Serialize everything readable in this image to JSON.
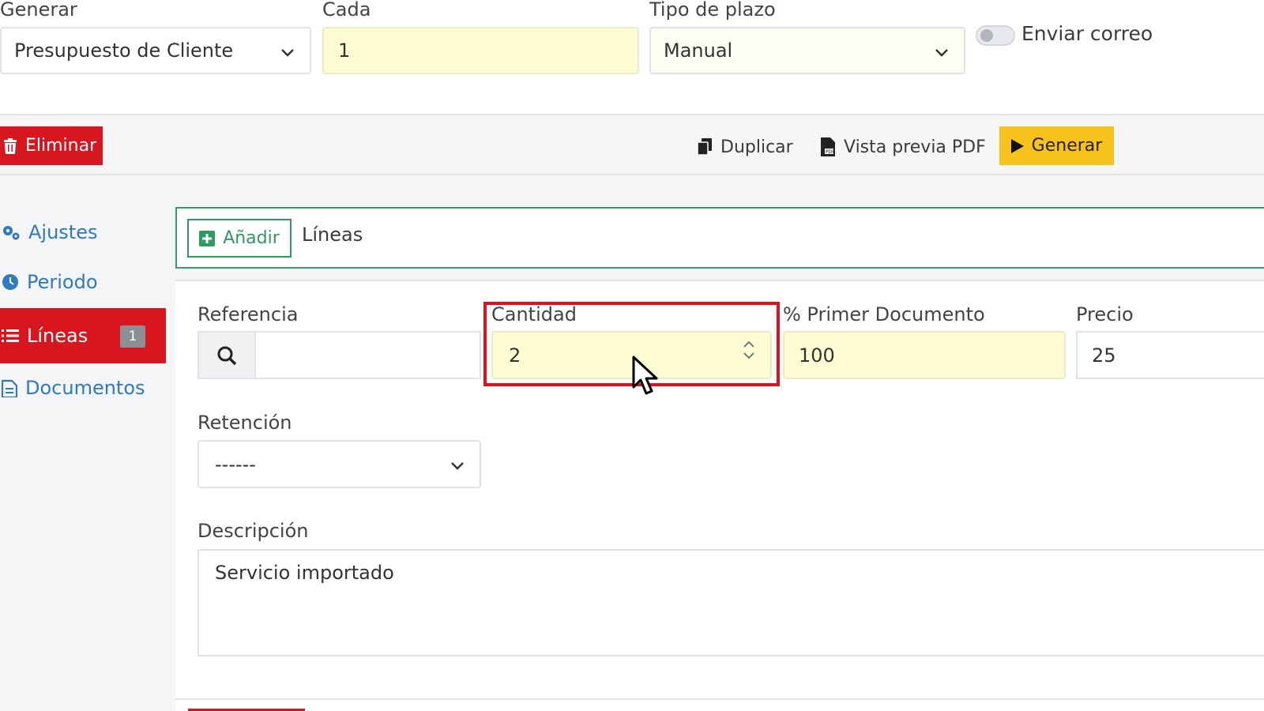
{
  "top": {
    "generate_label": "Generar",
    "generate_value": "Presupuesto de Cliente",
    "every_label": "Cada",
    "every_value": "1",
    "term_type_label": "Tipo de plazo",
    "term_type_value": "Manual",
    "send_email_label": "Enviar correo",
    "send_email_on": false
  },
  "toolbar": {
    "delete_label": "Eliminar",
    "duplicate_label": "Duplicar",
    "pdf_preview_label": "Vista previa PDF",
    "generate_label": "Generar"
  },
  "sidebar": {
    "items": [
      {
        "label": "Ajustes",
        "icon": "cogs-icon",
        "active": false
      },
      {
        "label": "Periodo",
        "icon": "clock-icon",
        "active": false
      },
      {
        "label": "Líneas",
        "icon": "list-icon",
        "active": true,
        "badge": "1"
      },
      {
        "label": "Documentos",
        "icon": "documents-icon",
        "active": false
      }
    ]
  },
  "lines": {
    "add_label": "Añadir",
    "title": "Líneas",
    "reference_label": "Referencia",
    "reference_value": "",
    "quantity_label": "Cantidad",
    "quantity_value": "2",
    "first_doc_label": "% Primer Documento",
    "first_doc_value": "100",
    "price_label": "Precio",
    "price_value": "25",
    "retention_label": "Retención",
    "retention_value": "------",
    "description_label": "Descripción",
    "description_value": "Servicio importado"
  },
  "colors": {
    "danger": "#d8161f",
    "warning": "#f7c21b",
    "success": "#2f9a5f",
    "link": "#2f79c3",
    "input_highlight": "#fdfcd3"
  }
}
